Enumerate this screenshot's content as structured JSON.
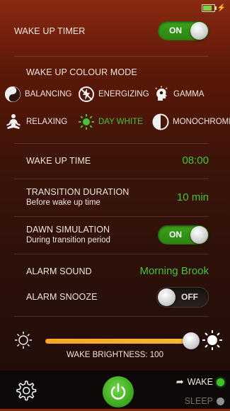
{
  "status": {
    "battery_level": 0.8,
    "charging_icon": "bolt-icon"
  },
  "wake_up_timer": {
    "label": "WAKE UP TIMER",
    "toggle": "ON",
    "state": true
  },
  "colour_mode": {
    "heading": "WAKE UP COLOUR MODE",
    "modes": [
      {
        "label": "BALANCING",
        "icon": "yin-yang-icon",
        "active": false
      },
      {
        "label": "ENERGIZING",
        "icon": "energizing-icon",
        "active": false
      },
      {
        "label": "GAMMA",
        "icon": "gamma-head-icon",
        "active": false
      },
      {
        "label": "RELAXING",
        "icon": "meditation-icon",
        "active": false
      },
      {
        "label": "DAY WHITE",
        "icon": "sun-icon",
        "active": true
      },
      {
        "label": "MONOCHROME",
        "icon": "half-circle-icon",
        "active": false
      }
    ]
  },
  "wake_up_time": {
    "label": "WAKE UP TIME",
    "value": "08:00"
  },
  "transition": {
    "label": "TRANSITION DURATION",
    "sublabel": "Before wake up time",
    "value": "10 min"
  },
  "dawn_simulation": {
    "label": "DAWN SIMULATION",
    "sublabel": "During transition period",
    "toggle": "ON",
    "state": true
  },
  "alarm_sound": {
    "label": "ALARM SOUND",
    "value": "Morning Brook"
  },
  "alarm_snooze": {
    "label": "ALARM SNOOZE",
    "toggle": "OFF",
    "state": false
  },
  "brightness": {
    "label": "WAKE BRIGHTNESS: 100",
    "level": 1.0
  },
  "bottom": {
    "wake_label": "WAKE",
    "sleep_label": "SLEEP",
    "wake_color": "#3ec12a",
    "sleep_color": "#8f8f8f"
  },
  "colors": {
    "accent": "#46c33a",
    "slider": "#f5a623"
  }
}
